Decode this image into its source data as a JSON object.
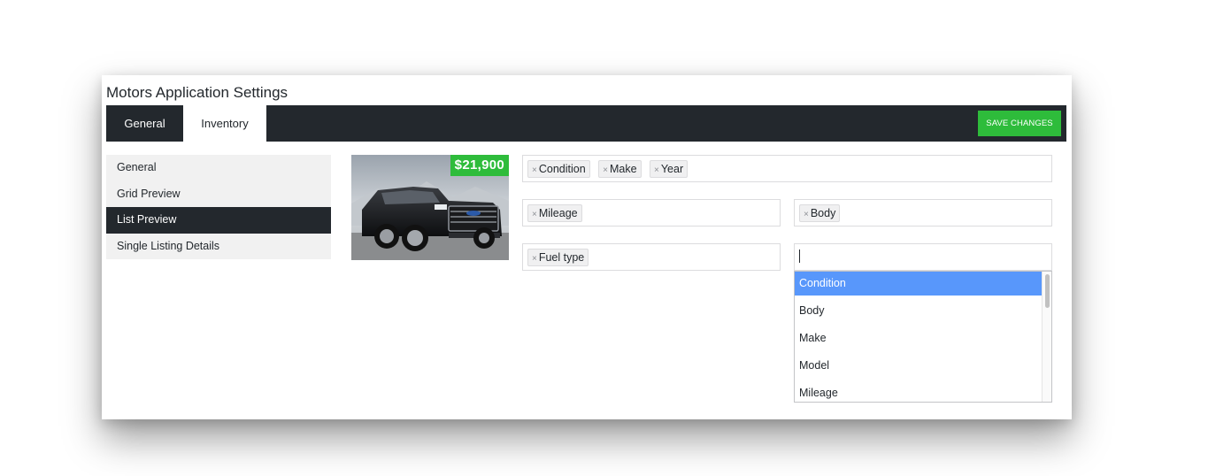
{
  "app": {
    "title": "Motors Application Settings"
  },
  "tabs": [
    {
      "label": "General",
      "active": false
    },
    {
      "label": "Inventory",
      "active": true
    }
  ],
  "toolbar": {
    "save_label": "SAVE CHANGES"
  },
  "sidebar": {
    "items": [
      {
        "label": "General",
        "active": false
      },
      {
        "label": "Grid Preview",
        "active": false
      },
      {
        "label": "List Preview",
        "active": true
      },
      {
        "label": "Single Listing Details",
        "active": false
      }
    ]
  },
  "preview": {
    "price": "$21,900",
    "image": "black-pickup-truck"
  },
  "fields": {
    "row1": {
      "tags": [
        "Condition",
        "Make",
        "Year"
      ]
    },
    "row2_left": {
      "tags": [
        "Mileage"
      ]
    },
    "row2_right": {
      "tags": [
        "Body"
      ]
    },
    "row3_left": {
      "tags": [
        "Fuel type"
      ]
    },
    "row3_right": {
      "search_value": ""
    }
  },
  "dropdown": {
    "options": [
      "Condition",
      "Body",
      "Make",
      "Model",
      "Mileage"
    ],
    "highlighted": "Condition"
  },
  "colors": {
    "topbar": "#23282d",
    "accent_green": "#2ebc3b",
    "highlight_blue": "#5897fb"
  },
  "icons": {
    "tag_remove": "×"
  }
}
